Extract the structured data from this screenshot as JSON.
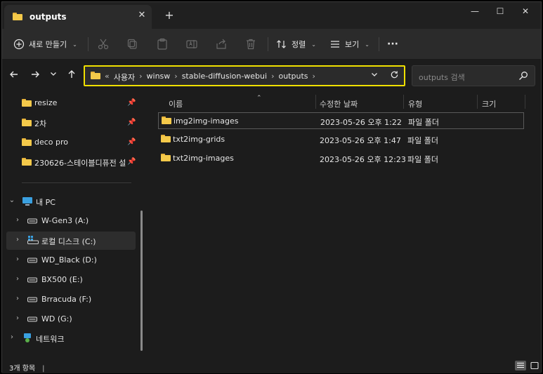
{
  "window": {
    "tab_title": "outputs",
    "tab_close": "✕",
    "new_tab": "+",
    "minimize": "—",
    "maximize": "☐",
    "close": "✕"
  },
  "toolbar": {
    "new_label": "새로 만들기",
    "sort_label": "정렬",
    "view_label": "보기",
    "more_label": "···"
  },
  "nav": {
    "breadcrumb_overflow": "«",
    "breadcrumb": [
      "사용자",
      "winsw",
      "stable-diffusion-webui",
      "outputs"
    ],
    "search_placeholder": "outputs 검색"
  },
  "sidebar": {
    "pinned": [
      {
        "label": "resize"
      },
      {
        "label": "2차"
      },
      {
        "label": "deco pro"
      },
      {
        "label": "230626-스테이블디퓨전 설"
      }
    ],
    "this_pc": "내 PC",
    "drives": [
      {
        "label": "W-Gen3 (A:)"
      },
      {
        "label": "로컬 디스크 (C:)"
      },
      {
        "label": "WD_Black (D:)"
      },
      {
        "label": "BX500 (E:)"
      },
      {
        "label": "Brracuda (F:)"
      },
      {
        "label": "WD (G:)"
      }
    ],
    "network": "네트워크"
  },
  "table": {
    "columns": [
      "이름",
      "수정한 날짜",
      "유형",
      "크기"
    ],
    "rows": [
      {
        "name": "img2img-images",
        "modified": "2023-05-26 오후 1:22",
        "type": "파일 폴더",
        "size": ""
      },
      {
        "name": "txt2img-grids",
        "modified": "2023-05-26 오후 1:47",
        "type": "파일 폴더",
        "size": ""
      },
      {
        "name": "txt2img-images",
        "modified": "2023-05-26 오후 12:23",
        "type": "파일 폴더",
        "size": ""
      }
    ]
  },
  "status": {
    "item_count": "3개 항목"
  },
  "colors": {
    "folder": "#f4c94a",
    "address_highlight": "#f0e000",
    "background": "#1c1c1c"
  }
}
